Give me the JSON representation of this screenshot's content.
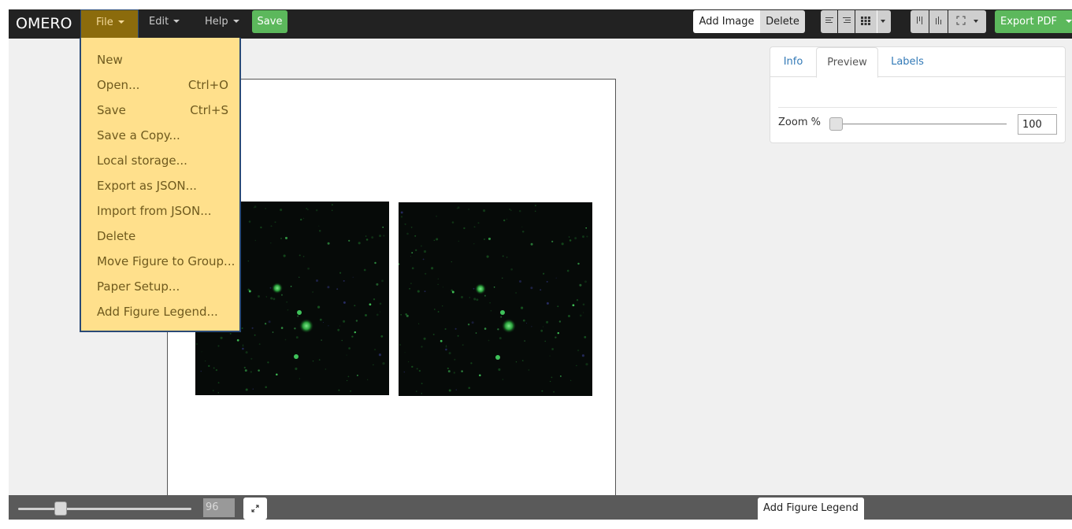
{
  "app": {
    "brand": "OMERO"
  },
  "topbar": {
    "menus": [
      {
        "label": "File",
        "active": true
      },
      {
        "label": "Edit"
      },
      {
        "label": "Help"
      }
    ],
    "save_label": "Save",
    "add_image_label": "Add Image",
    "delete_label": "Delete",
    "export_label": "Export PDF",
    "toolbar_icons": [
      "align-left-icon",
      "align-right-icon",
      "grid-icon",
      "dropdown-caret-icon",
      "align-top-icon",
      "align-bottom-icon",
      "fullscreen-icon",
      "dropdown-caret-icon"
    ]
  },
  "file_menu": {
    "items": [
      {
        "label": "New",
        "shortcut": ""
      },
      {
        "label": "Open...",
        "shortcut": "Ctrl+O"
      },
      {
        "label": "Save",
        "shortcut": "Ctrl+S"
      },
      {
        "label": "Save a Copy...",
        "shortcut": ""
      },
      {
        "label": "Local storage...",
        "shortcut": ""
      },
      {
        "label": "Export as JSON...",
        "shortcut": ""
      },
      {
        "label": "Import from JSON...",
        "shortcut": ""
      },
      {
        "label": "Delete",
        "shortcut": ""
      },
      {
        "label": "Move Figure to Group...",
        "shortcut": ""
      },
      {
        "label": "Paper Setup...",
        "shortcut": ""
      },
      {
        "label": "Add Figure Legend...",
        "shortcut": ""
      }
    ]
  },
  "side_panel": {
    "tabs": [
      {
        "label": "Info"
      },
      {
        "label": "Preview",
        "active": true
      },
      {
        "label": "Labels"
      }
    ],
    "zoom_label": "Zoom %",
    "zoom_value": "100"
  },
  "bottombar": {
    "zoom_value": "96",
    "add_legend_label": "Add Figure Legend"
  },
  "colors": {
    "topbar": "#222222",
    "menu_active": "#8b6b0c",
    "dropdown_bg": "#ffe08c",
    "dropdown_text": "#6f5a1e",
    "save_green": "#5cb85c",
    "canvas_bg": "#f0f0f0",
    "bottombar": "#5a5a5a",
    "tab_link": "#337ab7"
  }
}
